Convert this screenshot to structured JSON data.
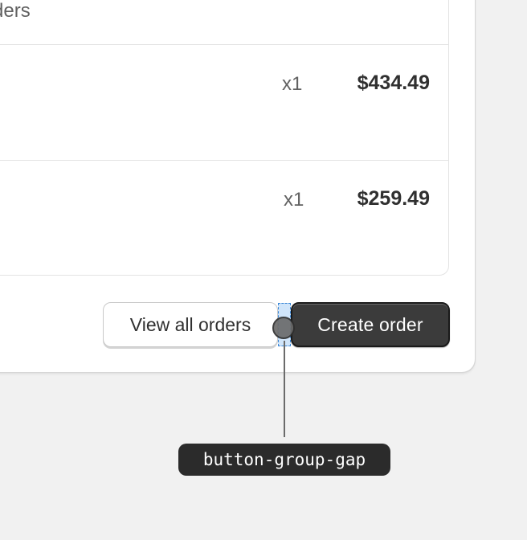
{
  "orders_panel": {
    "header_text": "ders",
    "rows": [
      {
        "quantity": "x1",
        "price": "$434.49"
      },
      {
        "quantity": "x1",
        "price": "$259.49"
      }
    ]
  },
  "actions": {
    "view_all_label": "View all orders",
    "create_label": "Create order"
  },
  "annotation": {
    "label": "button-group-gap",
    "highlight_color": "#3a86d6"
  },
  "colors": {
    "background": "#f1f1f1",
    "primary_button": "#3b3b3b",
    "text": "#303030",
    "muted_text": "#616161"
  }
}
